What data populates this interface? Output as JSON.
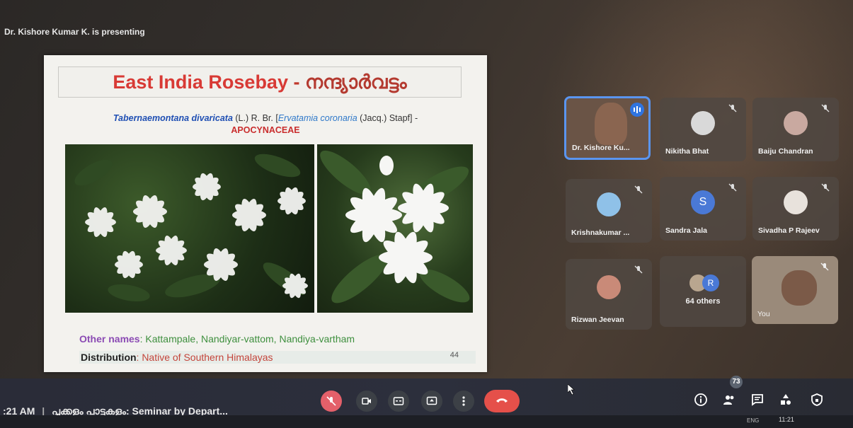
{
  "presenter_banner": "Dr. Kishore Kumar K. is presenting",
  "slide": {
    "title_en": "East India Rosebay",
    "title_sep": " - ",
    "title_ml": "നന്ദ്യാർവട്ടം",
    "sci_name": "Tabernaemontana divaricata",
    "sci_author": " (L.) R. Br.  [",
    "sci_synonym": "Ervatamia coronaria",
    "sci_synonym_author": " (Jacq.) Stapf] -",
    "family": "APOCYNACEAE",
    "other_names_label": "Other names",
    "other_names_value": ": Kattampale, Nandiyar-vattom, Nandiya-vartham",
    "distribution_label": "Distribution",
    "distribution_value": ": Native of Southern Himalayas",
    "page_number": "44"
  },
  "participants": [
    {
      "name": "Dr. Kishore Ku...",
      "speaking": true
    },
    {
      "name": "Nikitha Bhat",
      "muted": true
    },
    {
      "name": "Baiju Chandran",
      "muted": true
    },
    {
      "name": "Krishnakumar ...",
      "muted": true
    },
    {
      "name": "Sandra Jala",
      "muted": true,
      "initial": "S"
    },
    {
      "name": "Sivadha P Rajeev",
      "muted": true
    },
    {
      "name": "Rizwan Jeevan",
      "muted": true
    },
    {
      "name": "64 others",
      "initial": "R"
    },
    {
      "name": "You",
      "muted": true
    }
  ],
  "meeting": {
    "time": ":21 AM",
    "separator": "|",
    "title": "പൂക്കളും പാട്ടുകളും: Seminar by Depart..."
  },
  "controls": {
    "people_count": "73",
    "icons": [
      "mic-off-icon",
      "camera-icon",
      "captions-icon",
      "present-icon",
      "more-icon",
      "end-call-icon",
      "info-icon",
      "people-icon",
      "chat-icon",
      "activities-icon",
      "host-controls-icon"
    ]
  },
  "taskbar": {
    "lang": "ENG",
    "time": "11:21"
  },
  "colors": {
    "title_red": "#d83a35",
    "accent_blue": "#5a95f0",
    "end_call": "#e5504a",
    "mic_off": "#e4606a"
  }
}
